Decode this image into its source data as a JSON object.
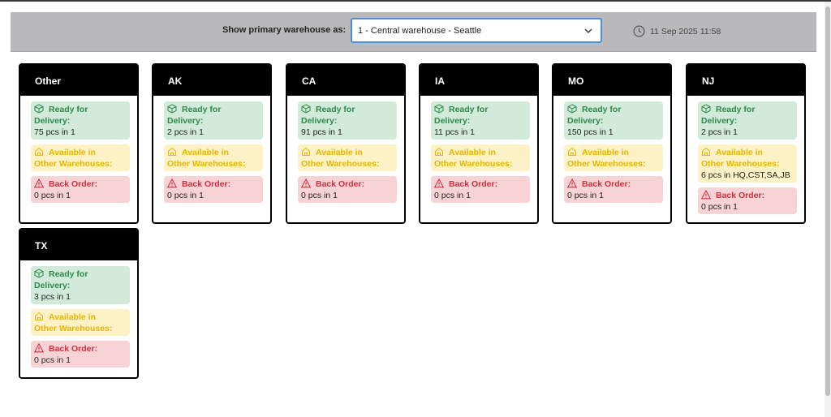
{
  "toolbar": {
    "label": "Show primary warehouse as:",
    "select_value": "1 - Central warehouse - Seattle",
    "timestamp": "11 Sep 2025 11:58"
  },
  "labels": {
    "ready_line1": "Ready for",
    "ready_line2": "Delivery:",
    "avail_line1": "Available in",
    "avail_line2": "Other Warehouses:",
    "back_order": "Back Order:"
  },
  "colors": {
    "ready": "#2e8a4a",
    "available": "#e9b500",
    "back_order": "#cf2f3f",
    "select_border": "#4a90d9"
  },
  "icons": {
    "ready": "box-icon",
    "available": "warehouse-icon",
    "back_order": "warning-icon",
    "timestamp": "clock-icon",
    "select": "chevron-down-icon"
  },
  "cards": [
    {
      "name": "Other",
      "ready": "75 pcs in 1",
      "available": "",
      "back_order": "0 pcs in 1"
    },
    {
      "name": "AK",
      "ready": "2 pcs in 1",
      "available": "",
      "back_order": "0 pcs in 1"
    },
    {
      "name": "CA",
      "ready": "91 pcs in 1",
      "available": "",
      "back_order": "0 pcs in 1"
    },
    {
      "name": "IA",
      "ready": "11 pcs in 1",
      "available": "",
      "back_order": "0 pcs in 1"
    },
    {
      "name": "MO",
      "ready": "150 pcs in 1",
      "available": "",
      "back_order": "0 pcs in 1"
    },
    {
      "name": "NJ",
      "ready": "2 pcs in 1",
      "available": "6 pcs in HQ,CST,SA,JB",
      "back_order": "0 pcs in 1"
    },
    {
      "name": "TX",
      "ready": "3 pcs in 1",
      "available": "",
      "back_order": "0 pcs in 1"
    }
  ]
}
